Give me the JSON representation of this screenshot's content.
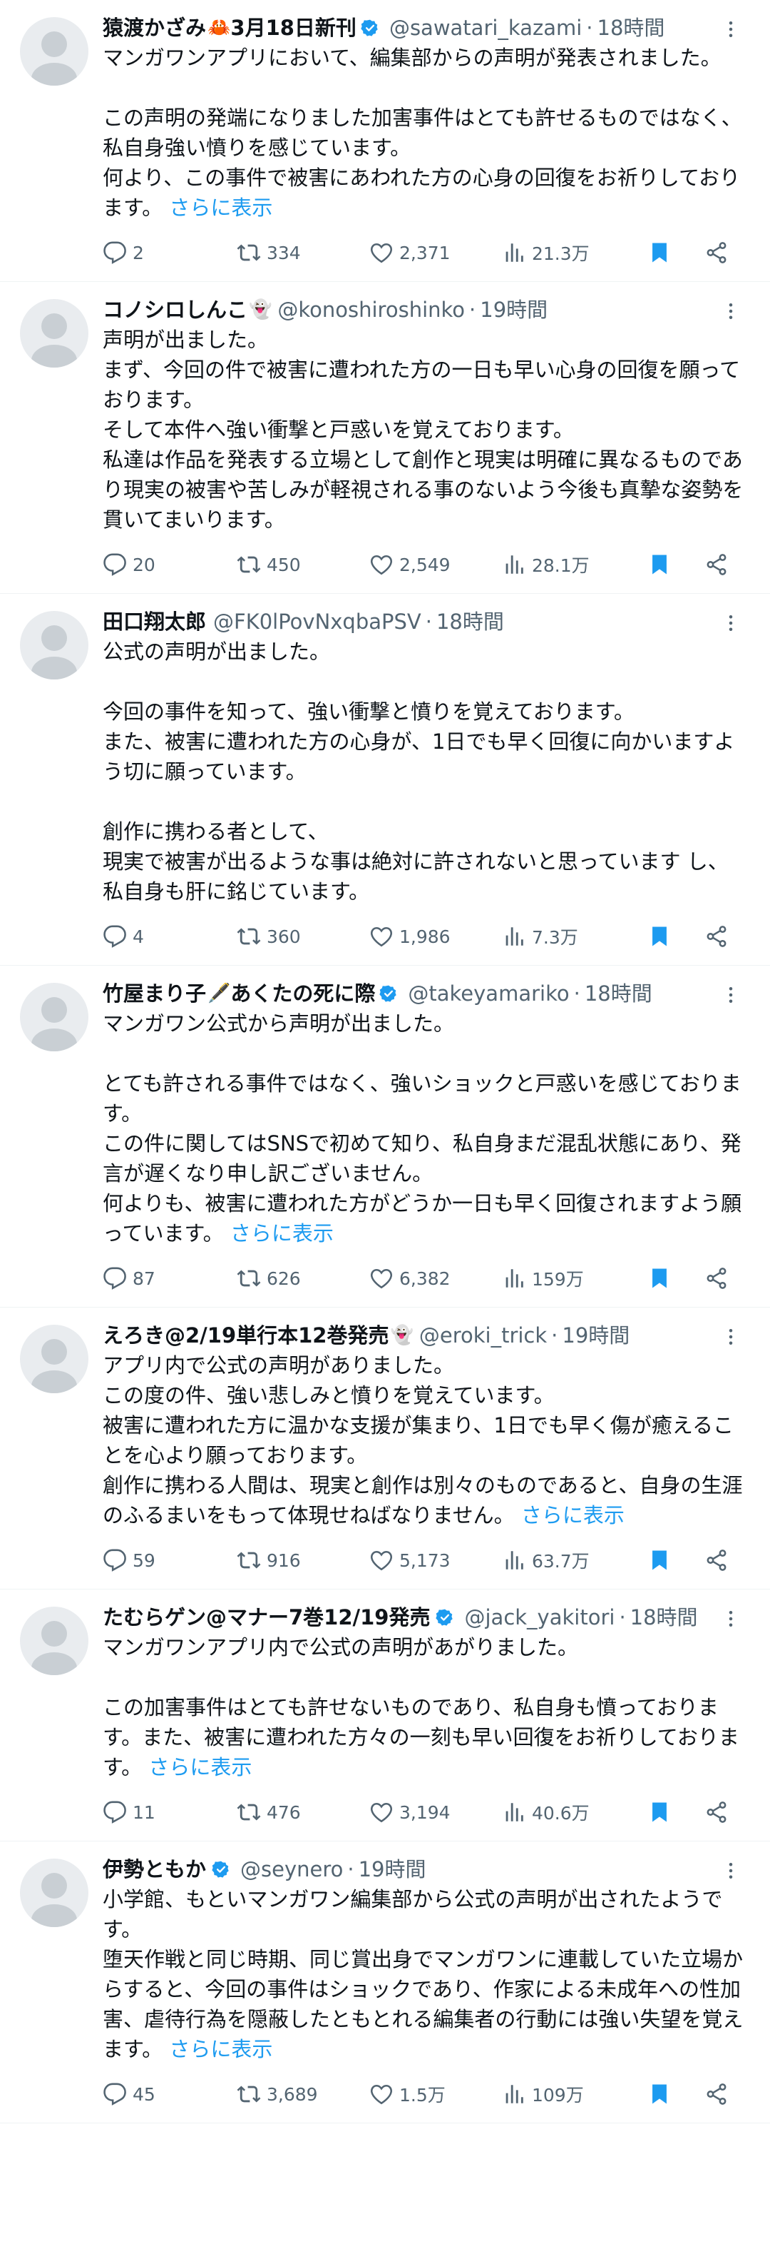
{
  "colors": {
    "accent": "#1d9bf0",
    "text": "#0f1419",
    "muted": "#536471",
    "border": "#eff3f4"
  },
  "tweets": [
    {
      "name": "猿渡かざみ",
      "name_emoji": "🦀",
      "name_suffix": "3月18日新刊",
      "verified": true,
      "handle": "@sawatari_kazami",
      "time": "18時間",
      "body": "マンガワンアプリにおいて、編集部からの声明が発表されました。\n\nこの声明の発端になりました加害事件はとても許せるものではなく、私自身強い憤りを感じています。\n何より、この事件で被害にあわれた方の心身の回復をお祈りしております。",
      "show_more": "さらに表示",
      "replies": "2",
      "reposts": "334",
      "likes": "2,371",
      "views": "21.3万"
    },
    {
      "name": "コノシロしんこ",
      "name_emoji": "👻",
      "name_suffix": "",
      "verified": false,
      "handle": "@konoshiroshinko",
      "time": "19時間",
      "body": "声明が出ました。\nまず、今回の件で被害に遭われた方の一日も早い心身の回復を願っております。\nそして本件へ強い衝撃と戸惑いを覚えております。\n私達は作品を発表する立場として創作と現実は明確に異なるものであり現実の被害や苦しみが軽視される事のないよう今後も真摯な姿勢を貫いてまいります。",
      "show_more": "",
      "replies": "20",
      "reposts": "450",
      "likes": "2,549",
      "views": "28.1万"
    },
    {
      "name": "田口翔太郎",
      "name_emoji": "",
      "name_suffix": "",
      "verified": false,
      "handle": "@FK0lPovNxqbaPSV",
      "time": "18時間",
      "body": "公式の声明が出ました。\n\n今回の事件を知って、強い衝撃と憤りを覚えております。\nまた、被害に遭われた方の心身が、1日でも早く回復に向かいますよう切に願っています。\n\n創作に携わる者として、\n現実で被害が出るような事は絶対に許されないと思っています し、\n私自身も肝に銘じています。",
      "show_more": "",
      "replies": "4",
      "reposts": "360",
      "likes": "1,986",
      "views": "7.3万"
    },
    {
      "name": "竹屋まり子",
      "name_emoji": "🖋️",
      "name_suffix": "あくたの死に際",
      "verified": true,
      "handle": "@takeyamariko",
      "time": "18時間",
      "body": "マンガワン公式から声明が出ました。\n\nとても許される事件ではなく、強いショックと戸惑いを感じております。\nこの件に関してはSNSで初めて知り、私自身まだ混乱状態にあり、発言が遅くなり申し訳ございません。\n何よりも、被害に遭われた方がどうか一日も早く回復されますよう願っています。",
      "show_more": "さらに表示",
      "replies": "87",
      "reposts": "626",
      "likes": "6,382",
      "views": "159万"
    },
    {
      "name": "えろき@2/19単行本12巻発売",
      "name_emoji": "👻",
      "name_suffix": "",
      "verified": false,
      "handle": "@eroki_trick",
      "time": "19時間",
      "body": "アプリ内で公式の声明がありました。\nこの度の件、強い悲しみと憤りを覚えています。\n被害に遭われた方に温かな支援が集まり、1日でも早く傷が癒えることを心より願っております。\n創作に携わる人間は、現実と創作は別々のものであると、自身の生涯のふるまいをもって体現せねばなりません。",
      "show_more": "さらに表示",
      "replies": "59",
      "reposts": "916",
      "likes": "5,173",
      "views": "63.7万"
    },
    {
      "name": "たむらゲン@マナー7巻12/19発売",
      "name_emoji": "",
      "name_suffix": "",
      "verified": true,
      "handle": "@jack_yakitori",
      "time": "18時間",
      "body": "マンガワンアプリ内で公式の声明があがりました。\n\nこの加害事件はとても許せないものであり、私自身も憤っております。また、被害に遭われた方々の一刻も早い回復をお祈りしております。",
      "show_more": "さらに表示",
      "replies": "11",
      "reposts": "476",
      "likes": "3,194",
      "views": "40.6万"
    },
    {
      "name": "伊勢ともか",
      "name_emoji": "",
      "name_suffix": "",
      "verified": true,
      "handle": "@seynero",
      "time": "19時間",
      "body": "小学館、もといマンガワン編集部から公式の声明が出されたようです。\n堕天作戦と同じ時期、同じ賞出身でマンガワンに連載していた立場からすると、今回の事件はショックであり、作家による未成年への性加害、虐待行為を隠蔽したともとれる編集者の行動には強い失望を覚えます。",
      "show_more": "さらに表示",
      "replies": "45",
      "reposts": "3,689",
      "likes": "1.5万",
      "views": "109万"
    }
  ]
}
